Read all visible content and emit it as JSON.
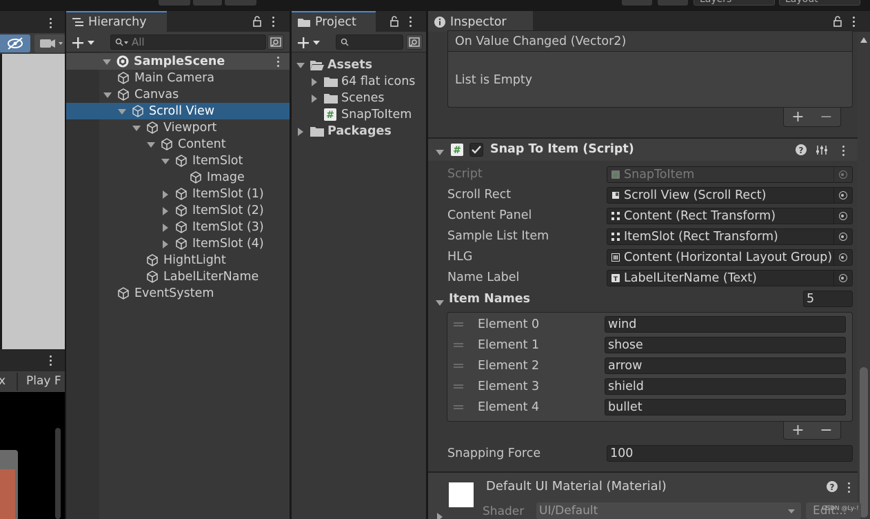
{
  "top": {
    "dropdowns": [
      "Layers",
      "Layout"
    ]
  },
  "left_panel": {
    "game_tab_partial": "x",
    "play_focus_partial": "Play F"
  },
  "hierarchy": {
    "tab_title": "Hierarchy",
    "search_placeholder": "All",
    "scene": "SampleScene",
    "items": [
      {
        "label": "Main Camera",
        "depth": 1,
        "arrow": "none",
        "selected": false
      },
      {
        "label": "Canvas",
        "depth": 1,
        "arrow": "down",
        "selected": false
      },
      {
        "label": "Scroll View",
        "depth": 2,
        "arrow": "down",
        "selected": true
      },
      {
        "label": "Viewport",
        "depth": 3,
        "arrow": "down",
        "selected": false
      },
      {
        "label": "Content",
        "depth": 4,
        "arrow": "down",
        "selected": false
      },
      {
        "label": "ItemSlot",
        "depth": 5,
        "arrow": "down",
        "selected": false
      },
      {
        "label": "Image",
        "depth": 6,
        "arrow": "none",
        "selected": false
      },
      {
        "label": "ItemSlot (1)",
        "depth": 5,
        "arrow": "right",
        "selected": false
      },
      {
        "label": "ItemSlot (2)",
        "depth": 5,
        "arrow": "right",
        "selected": false
      },
      {
        "label": "ItemSlot (3)",
        "depth": 5,
        "arrow": "right",
        "selected": false
      },
      {
        "label": "ItemSlot (4)",
        "depth": 5,
        "arrow": "right",
        "selected": false
      },
      {
        "label": "HightLight",
        "depth": 3,
        "arrow": "none",
        "selected": false
      },
      {
        "label": "LabelLiterName",
        "depth": 3,
        "arrow": "none",
        "selected": false
      },
      {
        "label": "EventSystem",
        "depth": 1,
        "arrow": "none",
        "selected": false
      }
    ]
  },
  "project": {
    "tab_title": "Project",
    "assets": "Assets",
    "folder1": "64 flat icons",
    "folder2": "Scenes",
    "script": "SnapToItem",
    "packages": "Packages"
  },
  "inspector": {
    "tab_title": "Inspector",
    "event_title": "On Value Changed (Vector2)",
    "event_empty": "List is Empty",
    "component_title": "Snap To Item (Script)",
    "fields": [
      {
        "label": "Script",
        "value": "SnapToItem",
        "icon": "script",
        "disabled": true
      },
      {
        "label": "Scroll Rect",
        "value": "Scroll View (Scroll Rect)",
        "icon": "scrollrect",
        "disabled": false
      },
      {
        "label": "Content Panel",
        "value": "Content (Rect Transform)",
        "icon": "recttransform",
        "disabled": false
      },
      {
        "label": "Sample List Item",
        "value": "ItemSlot (Rect Transform)",
        "icon": "recttransform",
        "disabled": false
      },
      {
        "label": "HLG",
        "value": "Content (Horizontal Layout Group)",
        "icon": "layout",
        "disabled": false
      },
      {
        "label": "Name Label",
        "value": "LabelLiterName (Text)",
        "icon": "text",
        "disabled": false
      }
    ],
    "item_names_label": "Item Names",
    "item_names_count": "5",
    "elements": [
      {
        "label": "Element 0",
        "value": "wind"
      },
      {
        "label": "Element 1",
        "value": "shose"
      },
      {
        "label": "Element 2",
        "value": "arrow"
      },
      {
        "label": "Element 3",
        "value": "shield"
      },
      {
        "label": "Element 4",
        "value": "bullet"
      }
    ],
    "snapping_force_label": "Snapping Force",
    "snapping_force_value": "100",
    "material_title": "Default UI Material (Material)",
    "shader_label": "Shader",
    "shader_value": "UI/Default",
    "edit_button": "Edit...",
    "plus": "+",
    "minus": "−"
  },
  "watermark": "CSDN @Ly-!"
}
